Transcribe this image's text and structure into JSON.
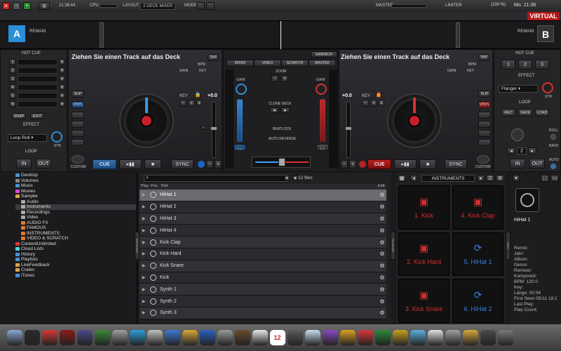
{
  "menubar": {
    "time": "21:38:44",
    "cpu_label": "CPU",
    "layout_label": "LAYOUT",
    "layout_value": "2 DECK MIXER",
    "mode_label": "MODE",
    "master_label": "MASTER",
    "limiter_label": "LIMITER",
    "battery": "(100 %)",
    "clock": "Mo. 21:38",
    "brand": "VIRTUAL DJ"
  },
  "decks": {
    "left": {
      "letter": "A",
      "remain": "REMAIN",
      "track_prompt": "Ziehen Sie einen Track auf das Deck",
      "bpm_label": "BPM",
      "gain_label": "GAIN",
      "key_label": "KEY",
      "tap": "TAP",
      "pitch": "+0.0",
      "cue": "CUE",
      "sync": "SYNC",
      "custom": "CUSTOM",
      "slip": "SLIP",
      "vinyl": "VINYL"
    },
    "right": {
      "letter": "B",
      "remain": "REMAIN",
      "track_prompt": "Ziehen Sie einen Track auf das Deck",
      "bpm_label": "BPM",
      "gain_label": "GAIN",
      "key_label": "KEY",
      "tap": "TAP",
      "pitch": "+0.0",
      "cue": "CUE",
      "sync": "SYNC",
      "custom": "CUSTOM",
      "slip": "SLIP",
      "vinyl": "VINYL"
    }
  },
  "left_panel": {
    "hotcue": "HOT CUE",
    "cues": [
      "1",
      "2",
      "3",
      "4",
      "5",
      "6"
    ],
    "snap": "SNAP",
    "edit": "EDIT",
    "effect": "EFFECT",
    "effect_value": "Loop Roll",
    "str": "STR",
    "loop": "LOOP",
    "in": "IN",
    "out": "OUT"
  },
  "right_panel": {
    "hotcue": "HOT CUE",
    "cues": [
      "1",
      "2",
      "3"
    ],
    "effect": "EFFECT",
    "effect_value": "Flanger",
    "str": "STR",
    "loop": "LOOP",
    "rec": "REC",
    "save": "SAVE",
    "load": "LOAD",
    "roll": "ROLL",
    "back": "BACK",
    "loop_size": "2",
    "in": "IN",
    "out": "OUT",
    "auto": "AUTO"
  },
  "mixer": {
    "sandbox": "SANDBOX",
    "tabs": [
      "MIXER",
      "VIDEO",
      "SCRATCH",
      "MASTER"
    ],
    "zoom": "ZOOM",
    "gain": "GAIN",
    "clone_deck": "CLONE DECK",
    "beatlock": "BEATLOCK",
    "auto_reverse": "AUTO REVERSE"
  },
  "browser": {
    "tree": [
      {
        "label": "Desktop",
        "indent": 0,
        "color": "#4a8fd8"
      },
      {
        "label": "Volumes",
        "indent": 0,
        "color": "#8a8a8a"
      },
      {
        "label": "Music",
        "indent": 0,
        "color": "#4a8fd8"
      },
      {
        "label": "Movies",
        "indent": 0,
        "color": "#d84ad8"
      },
      {
        "label": "Sampler",
        "indent": 0,
        "color": "#d8a84a"
      },
      {
        "label": "Audio",
        "indent": 1,
        "color": "#aaa"
      },
      {
        "label": "Instruments",
        "indent": 1,
        "color": "#aaa",
        "selected": true
      },
      {
        "label": "Recordings",
        "indent": 1,
        "color": "#aaa"
      },
      {
        "label": "Video",
        "indent": 1,
        "color": "#aaa"
      },
      {
        "label": "AUDIO FX",
        "indent": 1,
        "color": "#e07a2a"
      },
      {
        "label": "FAMOUS",
        "indent": 1,
        "color": "#e07a2a"
      },
      {
        "label": "INSTRUMENTS",
        "indent": 1,
        "color": "#e07a2a"
      },
      {
        "label": "VIDEO & SCRATCH",
        "indent": 1,
        "color": "#e07a2a"
      },
      {
        "label": "ContentUnlimited",
        "indent": 0,
        "color": "#d83a3a"
      },
      {
        "label": "Cloud Lists",
        "indent": 0,
        "color": "#4ad8d8"
      },
      {
        "label": "History",
        "indent": 0,
        "color": "#4a8fd8"
      },
      {
        "label": "Playlists",
        "indent": 0,
        "color": "#4a8fd8"
      },
      {
        "label": "LiveFeedback",
        "indent": 0,
        "color": "#d8a84a"
      },
      {
        "label": "Crates",
        "indent": 0,
        "color": "#d8a84a"
      },
      {
        "label": "iTunes",
        "indent": 0,
        "color": "#4a8fd8"
      }
    ],
    "file_count": "12 files",
    "columns": {
      "play": "Play",
      "pos": "Pos",
      "title": "Titel",
      "edit": "Edit"
    },
    "rows": [
      "HiHat 1",
      "HiHat 2",
      "HiHat 3",
      "HiHat 4",
      "Kick Clap",
      "Kick Hard",
      "Kick Snare",
      "Kick",
      "Synth 1",
      "Synth 2",
      "Synth 3"
    ]
  },
  "sampler": {
    "title": "INSTRUMENTS",
    "pads": [
      {
        "label": "1. Kick",
        "color": "red"
      },
      {
        "label": "4. Kick Clap",
        "color": "red"
      },
      {
        "label": "2. Kick Hard",
        "color": "red"
      },
      {
        "label": "5. HiHat 1",
        "color": "blue"
      },
      {
        "label": "3. Kick Snare",
        "color": "red"
      },
      {
        "label": "6. HiHat 2",
        "color": "blue"
      }
    ]
  },
  "info": {
    "title": "HiHat 1",
    "fields": [
      "Remix:",
      "Jahr:",
      "Album:",
      "Genre:",
      "Remixer:",
      "Komponist:",
      "BPM:   120.0",
      "Key:",
      "Länge:  00:04",
      "First Seen 05/11 18:1",
      "Last Play:",
      "Play Count:"
    ]
  },
  "side_tabs": {
    "browser": "BROWSER",
    "sampler": "SAMPLER",
    "info": "INFO"
  },
  "dock": {
    "calendar_day": "12"
  }
}
